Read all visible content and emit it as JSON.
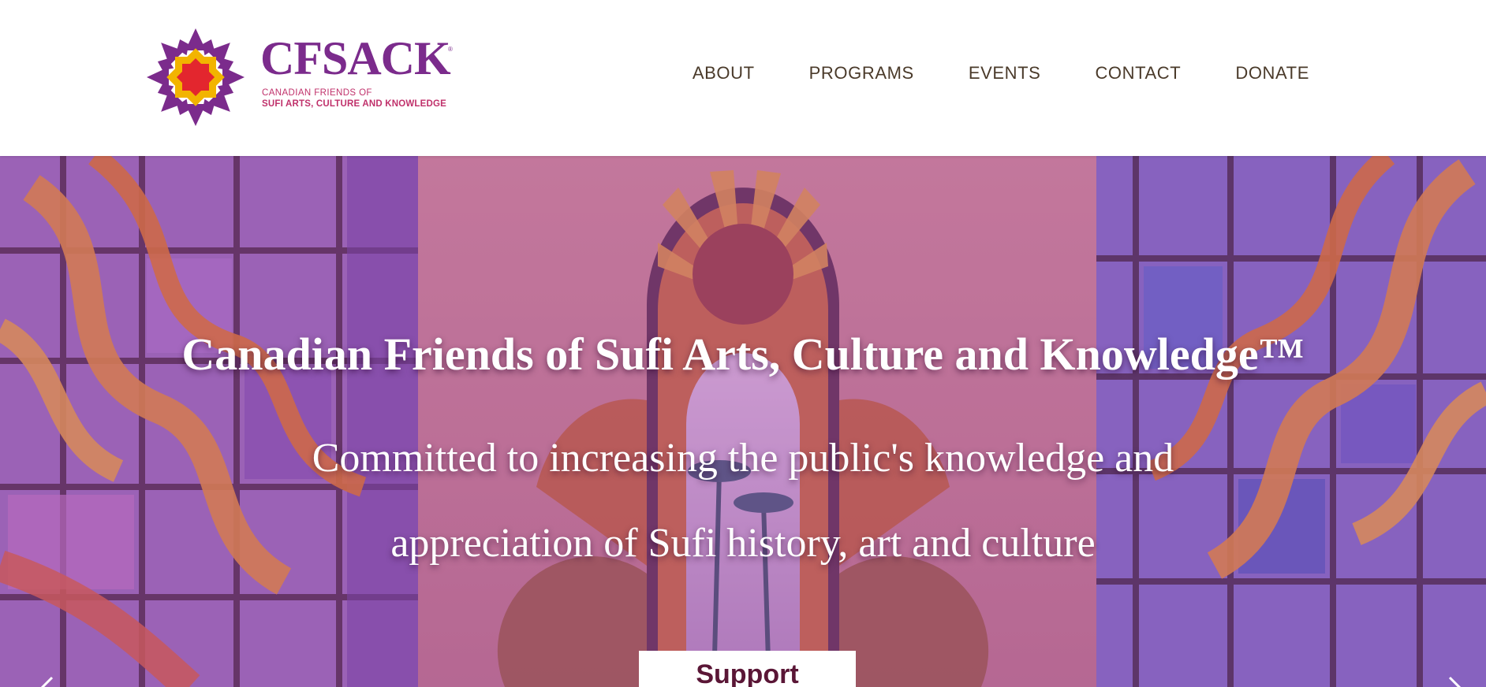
{
  "logo": {
    "name": "CFSACK",
    "tagline_line1": "CANADIAN FRIENDS OF",
    "tagline_line2": "SUFI ARTS, CULTURE AND KNOWLEDGE",
    "icon": "star-mandala-logo"
  },
  "nav": {
    "items": [
      {
        "label": "ABOUT"
      },
      {
        "label": "PROGRAMS"
      },
      {
        "label": "EVENTS"
      },
      {
        "label": "CONTACT"
      },
      {
        "label": "DONATE"
      }
    ]
  },
  "hero": {
    "title": "Canadian Friends of Sufi Arts, Culture and Knowledge™",
    "subtitle": "Committed to increasing the public's knowledge and appreciation of Sufi history, art and culture",
    "button_label": "Support",
    "prev_icon": "chevron-left-icon",
    "next_icon": "chevron-right-icon"
  },
  "colors": {
    "brand_purple": "#7b2b8c",
    "brand_magenta": "#c0316b",
    "nav_text": "#4a3a2a",
    "button_text": "#5a1636",
    "hero_overlay": "#9a4aa0"
  }
}
